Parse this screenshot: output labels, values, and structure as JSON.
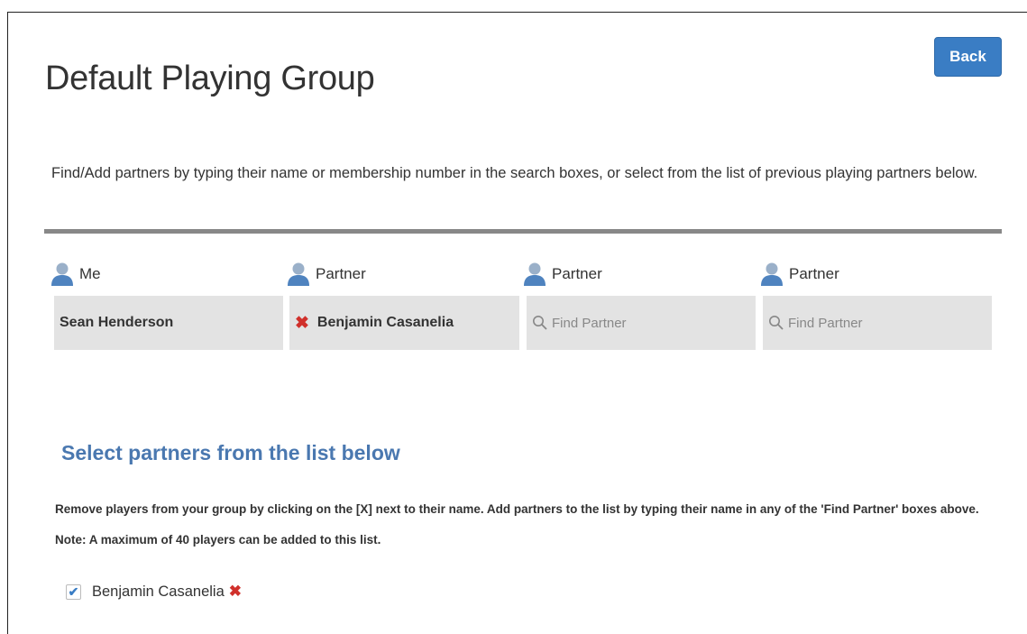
{
  "page": {
    "title": "Default Playing Group",
    "back_label": "Back",
    "intro": "Find/Add partners by typing their name or membership number in the search boxes, or select from the list of previous playing partners below."
  },
  "slots": [
    {
      "header": "Me",
      "name": "Sean Henderson",
      "icon": "person-icon"
    },
    {
      "header": "Partner",
      "name": "Benjamin Casanelia",
      "icon": "person-icon",
      "remove_icon": "close-icon"
    },
    {
      "header": "Partner",
      "placeholder": "Find Partner",
      "icon": "person-icon",
      "search_icon": "search-icon"
    },
    {
      "header": "Partner",
      "placeholder": "Find Partner",
      "icon": "person-icon",
      "search_icon": "search-icon"
    }
  ],
  "select_section": {
    "heading": "Select partners from the list below",
    "instructions": "Remove players from your group by clicking on the [X] next to their name. Add partners to the list by typing their name in any of the 'Find Partner' boxes above. Note: A maximum of 40 players can be added to this list.",
    "partners": [
      {
        "name": "Benjamin Casanelia",
        "checked": true
      }
    ]
  },
  "colors": {
    "accent": "#3a7dc4",
    "heading": "#4a78b0",
    "remove": "#d0302b",
    "slot_bg": "#e3e3e3",
    "divider": "#888888"
  }
}
